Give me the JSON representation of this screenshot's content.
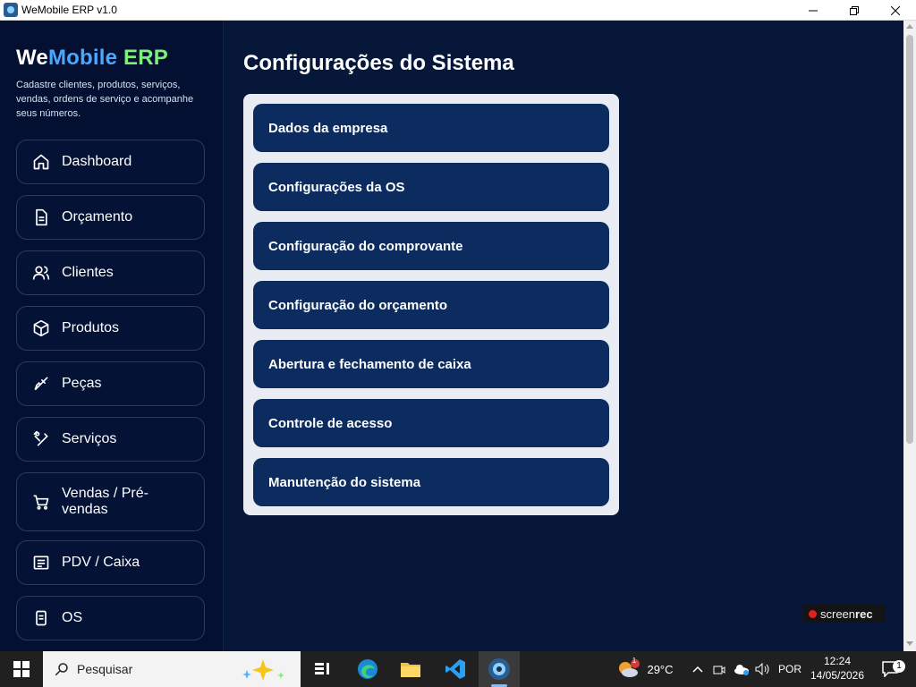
{
  "window": {
    "title": "WeMobile ERP v1.0"
  },
  "sidebar": {
    "brand": {
      "part1": "We",
      "part2": "Mobile",
      "part3": "ERP"
    },
    "tagline": "Cadastre clientes, produtos, serviços, vendas, ordens de serviço e acompanhe seus números.",
    "items": [
      {
        "label": "Dashboard",
        "icon": "home-icon"
      },
      {
        "label": "Orçamento",
        "icon": "document-icon"
      },
      {
        "label": "Clientes",
        "icon": "users-icon"
      },
      {
        "label": "Produtos",
        "icon": "box-icon"
      },
      {
        "label": "Peças",
        "icon": "brush-icon"
      },
      {
        "label": "Serviços",
        "icon": "tools-icon"
      },
      {
        "label": "Vendas / Pré-vendas",
        "icon": "cart-icon"
      },
      {
        "label": "PDV / Caixa",
        "icon": "register-icon"
      },
      {
        "label": "OS",
        "icon": "clipboard-icon"
      }
    ]
  },
  "main": {
    "title": "Configurações do Sistema",
    "options": [
      "Dados da empresa",
      "Configurações da OS",
      "Configuração do comprovante",
      "Configuração do orçamento",
      "Abertura e fechamento de caixa",
      "Controle de acesso",
      "Manutenção do sistema"
    ]
  },
  "watermark": {
    "part1": "screen",
    "part2": "rec"
  },
  "taskbar": {
    "search_placeholder": "Pesquisar",
    "weather_temp": "29°C",
    "weather_badge": "1",
    "language": "POR",
    "time": "12:24",
    "date": "14/05/2026",
    "notification_count": "1"
  },
  "colors": {
    "background": "#06173a",
    "sidebar": "#031032",
    "panel": "#e9edf3",
    "option_button": "#0c2b5f",
    "brand_blue": "#4aa8ff",
    "brand_green": "#7ef07a"
  }
}
